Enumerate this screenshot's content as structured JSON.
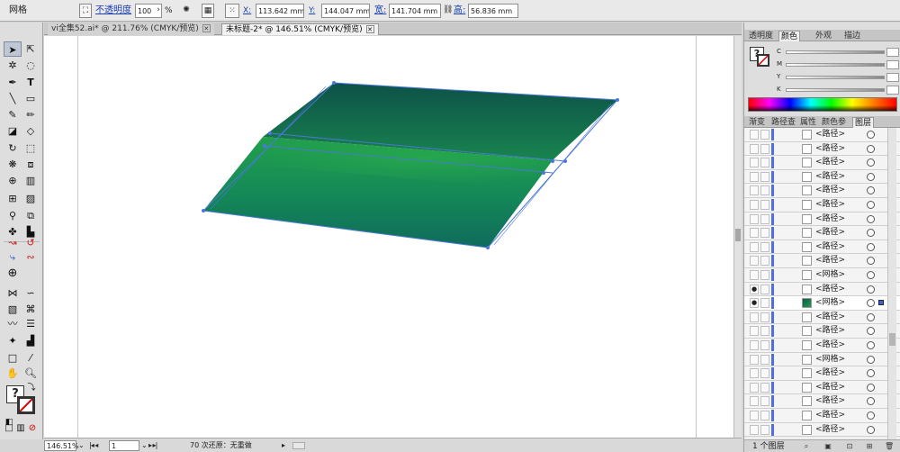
{
  "control_bar": {
    "selection_label": "网格",
    "opacity_label": "不透明度",
    "opacity_value": "100",
    "opacity_unit": "%",
    "x_label": "X:",
    "x_value": "113.642 mm",
    "y_label": "Y:",
    "y_value": "144.047 mm",
    "w_label": "宽:",
    "w_value": "141.704 mm",
    "h_label": "高:",
    "h_value": "56.836 mm"
  },
  "doc_tabs": [
    {
      "label": "vi全集52.ai* @ 211.76% (CMYK/预览)",
      "active": false
    },
    {
      "label": "未标题-2* @ 146.51% (CMYK/预览)",
      "active": true
    }
  ],
  "status_bar": {
    "zoom": "146.51%",
    "page": "1",
    "undo_status": "70 次还原：无重做"
  },
  "color_panel": {
    "tabs": [
      "透明度",
      "颜色",
      "外观",
      "描边"
    ],
    "active_tab": "颜色",
    "fill_indicator": "?",
    "channels": [
      "C",
      "M",
      "Y",
      "K"
    ]
  },
  "layers_panel": {
    "tabs": [
      "渐变",
      "路径查",
      "属性",
      "颜色参",
      "图层"
    ],
    "active_tab": "图层",
    "rows": [
      {
        "name": "<路径>",
        "eye": false,
        "selected": false
      },
      {
        "name": "<路径>",
        "eye": false,
        "selected": false
      },
      {
        "name": "<路径>",
        "eye": false,
        "selected": false
      },
      {
        "name": "<路径>",
        "eye": false,
        "selected": false
      },
      {
        "name": "<路径>",
        "eye": false,
        "selected": false
      },
      {
        "name": "<路径>",
        "eye": false,
        "selected": false
      },
      {
        "name": "<路径>",
        "eye": false,
        "selected": false
      },
      {
        "name": "<路径>",
        "eye": false,
        "selected": false
      },
      {
        "name": "<路径>",
        "eye": false,
        "selected": false
      },
      {
        "name": "<路径>",
        "eye": false,
        "selected": false
      },
      {
        "name": "<网格>",
        "eye": false,
        "selected": false
      },
      {
        "name": "<路径>",
        "eye": true,
        "selected": false
      },
      {
        "name": "<网格>",
        "eye": true,
        "selected": true
      },
      {
        "name": "<路径>",
        "eye": false,
        "selected": false
      },
      {
        "name": "<路径>",
        "eye": false,
        "selected": false
      },
      {
        "name": "<路径>",
        "eye": false,
        "selected": false
      },
      {
        "name": "<网格>",
        "eye": false,
        "selected": false
      },
      {
        "name": "<路径>",
        "eye": false,
        "selected": false
      },
      {
        "name": "<路径>",
        "eye": false,
        "selected": false
      },
      {
        "name": "<路径>",
        "eye": false,
        "selected": false
      },
      {
        "name": "<路径>",
        "eye": false,
        "selected": false
      },
      {
        "name": "<路径>",
        "eye": false,
        "selected": false
      }
    ],
    "footer_label": "1 个图层"
  },
  "colors": {
    "mesh_dark": "#0f5a4e",
    "mesh_light": "#219a4d",
    "mesh_edge": "#4b78d8",
    "layer_color": "#4f6fe0"
  }
}
